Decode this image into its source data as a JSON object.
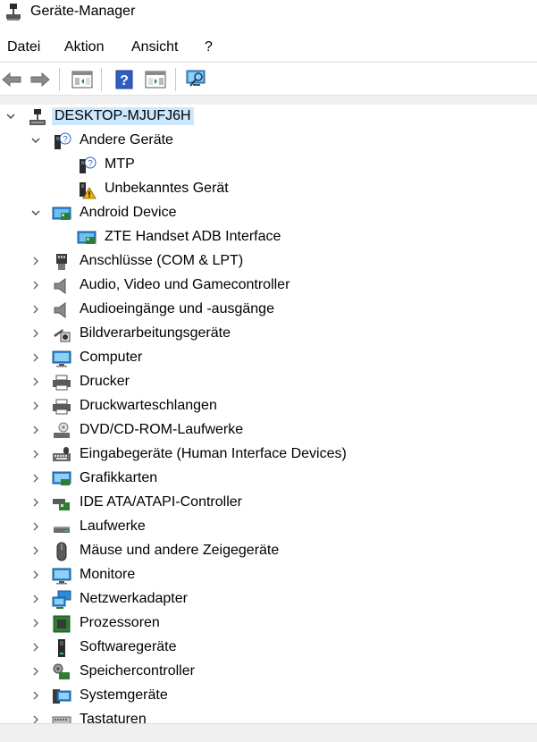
{
  "window": {
    "title": "Geräte-Manager"
  },
  "menu": [
    {
      "label": "Datei"
    },
    {
      "label": "Aktion"
    },
    {
      "label": "Ansicht"
    },
    {
      "label": "?"
    }
  ],
  "toolbar": {
    "buttons": [
      "back-icon",
      "forward-icon",
      "properties-icon",
      "help-icon",
      "update-driver-icon",
      "scan-hardware-icon"
    ]
  },
  "tree": {
    "root": {
      "label": "DESKTOP-MJUFJ6H",
      "icon": "computer-network-icon",
      "expanded": true
    },
    "nodes": [
      {
        "label": "Andere Geräte",
        "icon": "unknown-device-icon",
        "expanded": true,
        "children": [
          {
            "label": "MTP",
            "icon": "unknown-device-icon"
          },
          {
            "label": "Unbekanntes Gerät",
            "icon": "warning-device-icon"
          }
        ]
      },
      {
        "label": "Android Device",
        "icon": "android-device-icon",
        "expanded": true,
        "children": [
          {
            "label": "ZTE Handset ADB Interface",
            "icon": "android-device-icon"
          }
        ]
      },
      {
        "label": "Anschlüsse (COM & LPT)",
        "icon": "port-icon",
        "expanded": false
      },
      {
        "label": "Audio, Video und Gamecontroller",
        "icon": "speaker-icon",
        "expanded": false
      },
      {
        "label": "Audioeingänge und -ausgänge",
        "icon": "speaker-icon",
        "expanded": false
      },
      {
        "label": "Bildverarbeitungsgeräte",
        "icon": "camera-icon",
        "expanded": false
      },
      {
        "label": "Computer",
        "icon": "monitor-icon",
        "expanded": false
      },
      {
        "label": "Drucker",
        "icon": "printer-icon",
        "expanded": false
      },
      {
        "label": "Druckwarteschlangen",
        "icon": "printer-icon",
        "expanded": false
      },
      {
        "label": "DVD/CD-ROM-Laufwerke",
        "icon": "disc-drive-icon",
        "expanded": false
      },
      {
        "label": "Eingabegeräte (Human Interface Devices)",
        "icon": "hid-icon",
        "expanded": false
      },
      {
        "label": "Grafikkarten",
        "icon": "display-adapter-icon",
        "expanded": false
      },
      {
        "label": "IDE ATA/ATAPI-Controller",
        "icon": "ide-controller-icon",
        "expanded": false
      },
      {
        "label": "Laufwerke",
        "icon": "disk-drive-icon",
        "expanded": false
      },
      {
        "label": "Mäuse und andere Zeigegeräte",
        "icon": "mouse-icon",
        "expanded": false
      },
      {
        "label": "Monitore",
        "icon": "monitor-icon",
        "expanded": false
      },
      {
        "label": "Netzwerkadapter",
        "icon": "network-adapter-icon",
        "expanded": false
      },
      {
        "label": "Prozessoren",
        "icon": "processor-icon",
        "expanded": false
      },
      {
        "label": "Softwaregeräte",
        "icon": "software-device-icon",
        "expanded": false
      },
      {
        "label": "Speichercontroller",
        "icon": "storage-controller-icon",
        "expanded": false
      },
      {
        "label": "Systemgeräte",
        "icon": "system-device-icon",
        "expanded": false
      },
      {
        "label": "Tastaturen",
        "icon": "keyboard-icon",
        "expanded": false
      }
    ]
  }
}
